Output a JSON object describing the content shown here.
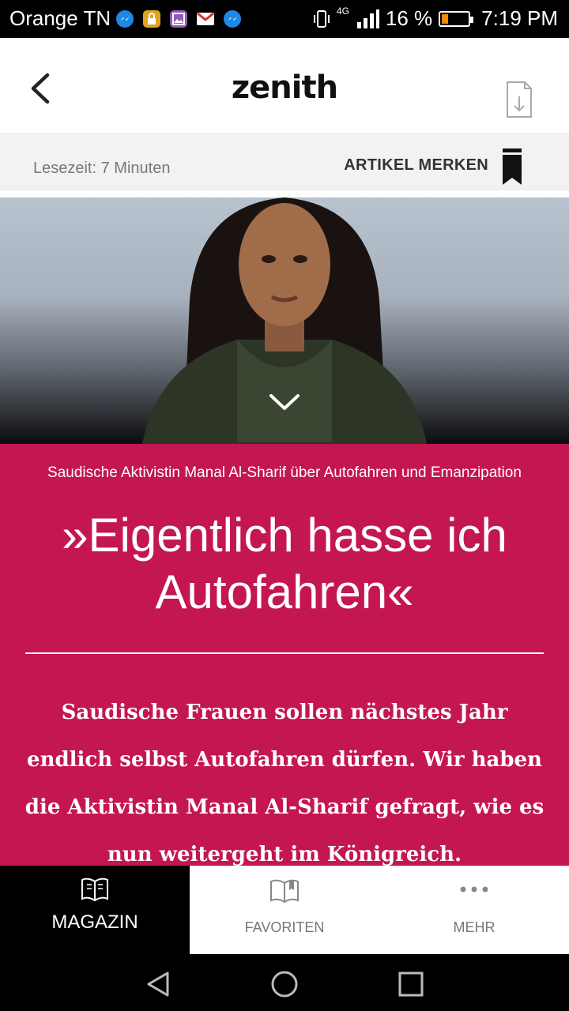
{
  "status_bar": {
    "carrier": "Orange TN",
    "network": "4G",
    "battery": "16 %",
    "time": "7:19 PM",
    "notification_icons": [
      "messenger-icon",
      "lock-app-icon",
      "gallery-icon",
      "gmail-icon",
      "messenger-icon"
    ]
  },
  "app_bar": {
    "logo": "zenith",
    "back_icon": "chevron-left-icon",
    "download_icon": "document-download-icon"
  },
  "info_bar": {
    "reading_time": "Lesezeit: 7 Minuten",
    "bookmark_label": "ARTIKEL MERKEN"
  },
  "article": {
    "kicker": "Saudische Aktivistin Manal Al-Sharif über Autofahren und Emanzipation",
    "headline": "»Eigentlich hasse ich Autofahren«",
    "lead": "Saudische Frauen sollen nächstes Jahr endlich selbst Autofahren dürfen. Wir haben die Aktivistin Manal Al-Sharif gefragt, wie es nun weitergeht im Königreich.",
    "accent_color": "#c41652"
  },
  "tabs": [
    {
      "label": "MAGAZIN",
      "icon": "open-book-icon",
      "active": true
    },
    {
      "label": "FAVORITEN",
      "icon": "bookmarked-book-icon",
      "active": false
    },
    {
      "label": "MEHR",
      "icon": "more-dots-icon",
      "active": false
    }
  ]
}
